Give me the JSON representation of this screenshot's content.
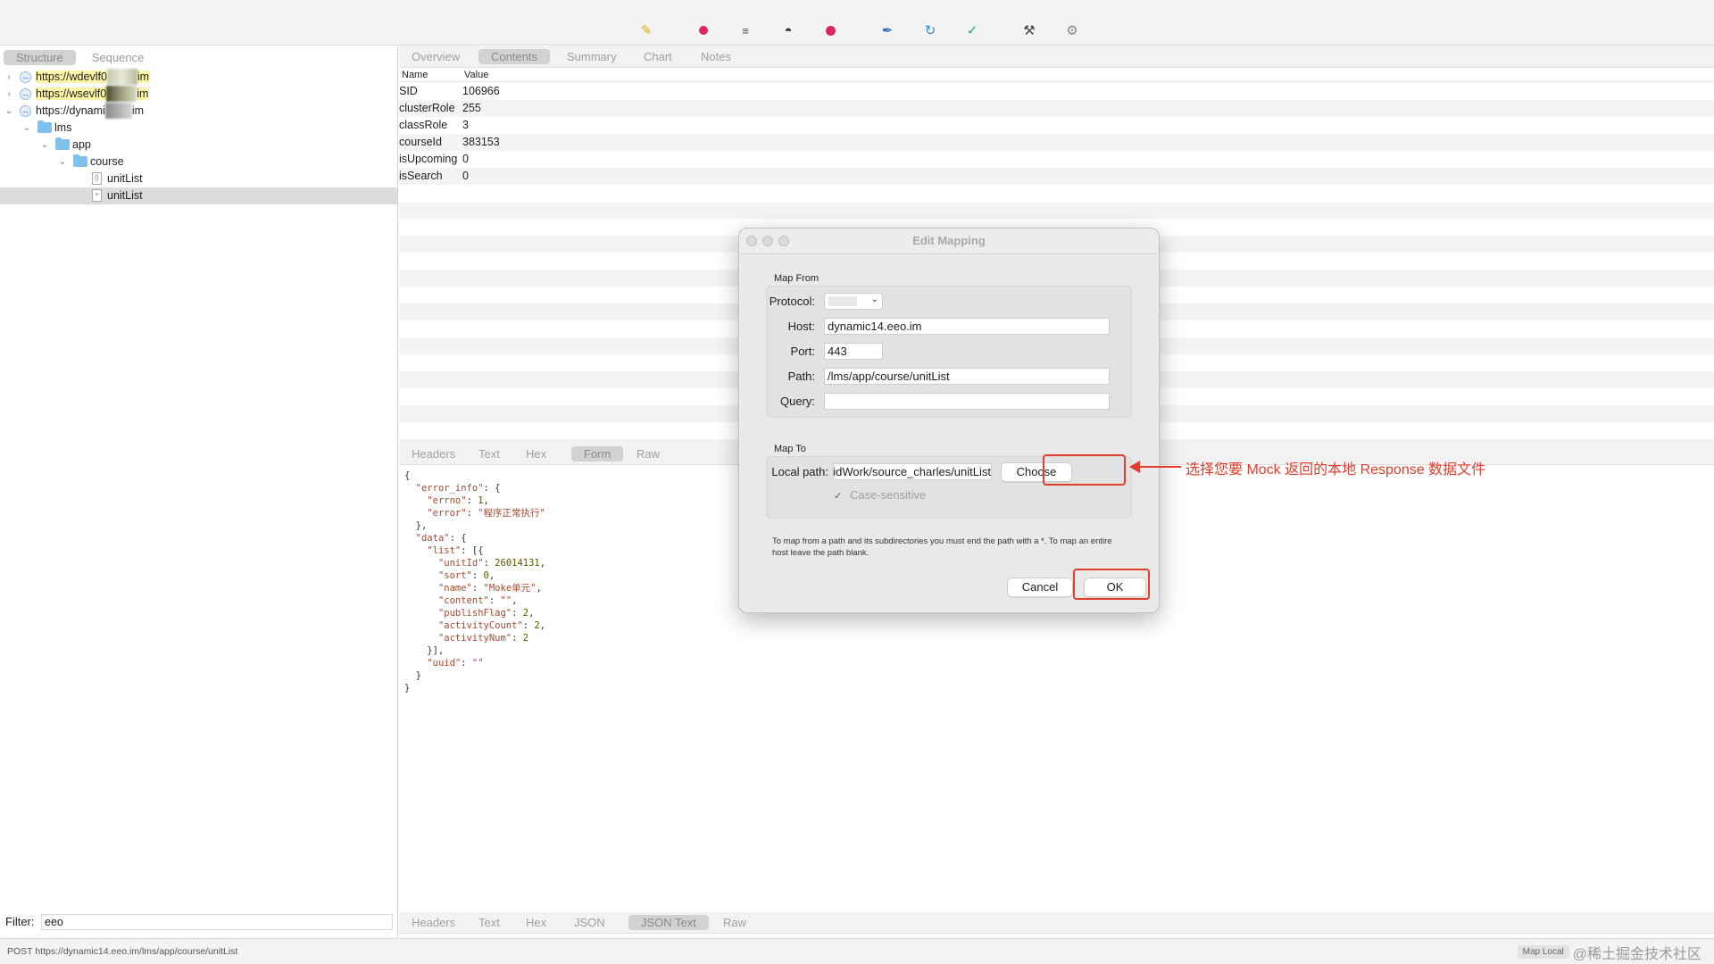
{
  "toolbar": {
    "icons": [
      "broom-icon",
      "record-icon",
      "throttle-icon",
      "turtle-icon",
      "stop-icon",
      "pen-icon",
      "refresh-icon",
      "check-icon",
      "tools-icon",
      "settings-icon"
    ]
  },
  "left": {
    "tabs": {
      "structure": "Structure",
      "sequence": "Sequence"
    },
    "tree": {
      "host1_prefix": "https://wdevlf0",
      "host1_suffix": "im",
      "host2_prefix": "https://wsevlf0",
      "host2_suffix": "im",
      "host3_prefix": "https://dynami",
      "host3_suffix": "im",
      "lms": "lms",
      "app": "app",
      "course": "course",
      "unitlist1": "unitList",
      "unitlist2": "unitList"
    },
    "filter_label": "Filter:",
    "filter_value": "eeo"
  },
  "right": {
    "top_tabs": [
      "Overview",
      "Contents",
      "Summary",
      "Chart",
      "Notes"
    ],
    "kv_headers": {
      "name": "Name",
      "value": "Value"
    },
    "kv_rows": [
      {
        "name": "SID",
        "value": "106966"
      },
      {
        "name": "clusterRole",
        "value": "255"
      },
      {
        "name": "classRole",
        "value": "3"
      },
      {
        "name": "courseId",
        "value": "383153"
      },
      {
        "name": "isUpcoming",
        "value": "0"
      },
      {
        "name": "isSearch",
        "value": "0"
      }
    ],
    "mid_tabs": [
      "Headers",
      "Text",
      "Hex",
      "Form",
      "Raw"
    ],
    "bottom_tabs": [
      "Headers",
      "Text",
      "Hex",
      "JSON",
      "JSON Text",
      "Raw"
    ],
    "json": {
      "open": "{",
      "error_info_key": "\"error_info\"",
      "errno_key": "\"errno\"",
      "errno_val": "1",
      "error_key": "\"error\"",
      "error_val": "\"程序正常执行\"",
      "data_key": "\"data\"",
      "list_key": "\"list\"",
      "unitId_key": "\"unitId\"",
      "unitId_val": "26014131",
      "sort_key": "\"sort\"",
      "sort_val": "0",
      "name_key": "\"name\"",
      "name_val": "\"Moke单元\"",
      "content_key": "\"content\"",
      "content_val": "\"\"",
      "publishFlag_key": "\"publishFlag\"",
      "publishFlag_val": "2",
      "activityCount_key": "\"activityCount\"",
      "activityCount_val": "2",
      "activityNum_key": "\"activityNum\"",
      "activityNum_val": "2",
      "uuid_key": "\"uuid\"",
      "uuid_val": "\"\"",
      "close": "}"
    }
  },
  "dialog": {
    "title": "Edit Mapping",
    "map_from": "Map From",
    "protocol_label": "Protocol:",
    "host_label": "Host:",
    "host_value": "dynamic14.eeo.im",
    "port_label": "Port:",
    "port_value": "443",
    "path_label": "Path:",
    "path_value": "/lms/app/course/unitList",
    "query_label": "Query:",
    "query_value": "",
    "map_to": "Map To",
    "local_path_label": "Local path:",
    "local_path_value": "droidWork/source_charles/unitList",
    "choose": "Choose",
    "case_sensitive": "Case-sensitive",
    "note": "To map from a path and its subdirectories you must end the path with a *. To map an entire host leave the path blank.",
    "cancel": "Cancel",
    "ok": "OK"
  },
  "annotation": "选择您要 Mock 返回的本地 Response 数据文件",
  "status": {
    "text": "POST https://dynamic14.eeo.im/lms/app/course/unitList",
    "map_local": "Map Local",
    "watermark": "@稀土掘金技术社区"
  },
  "colors": {
    "annotation_red": "#e23c2a",
    "highlight_yellow": "#fdf6a8",
    "folder_blue": "#7fc0ef"
  }
}
